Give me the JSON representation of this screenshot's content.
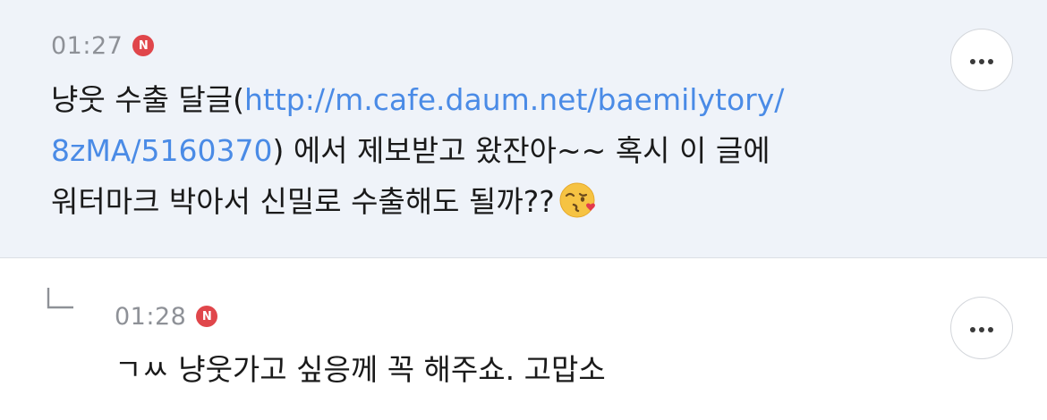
{
  "comments": [
    {
      "time": "01:27",
      "badge": "N",
      "text_before_link": "냥웃 수출 달글(",
      "link_line1": "http://m.cafe.daum.net/baemilytory/",
      "link_line2": "8zMA/5160370",
      "text_after_link": ") 에서 제보받고 왔잔아~~ 혹시 이 글에",
      "text_line3": "워터마크 박아서 신밀로 수출해도 될까??",
      "emoji_icon": "face-blowing-kiss-icon",
      "more_icon": "more-dots-icon"
    },
    {
      "time": "01:28",
      "badge": "N",
      "text": "ㄱㅆ 냥웃가고 싶응께 꼭 해주쇼. 고맙소",
      "reply_icon": "reply-arrow-icon",
      "more_icon": "more-dots-icon"
    }
  ],
  "colors": {
    "highlight_background": "#eff3f9",
    "badge": "#e0464b",
    "link": "#4a8be6",
    "time_text": "#8e9197"
  }
}
